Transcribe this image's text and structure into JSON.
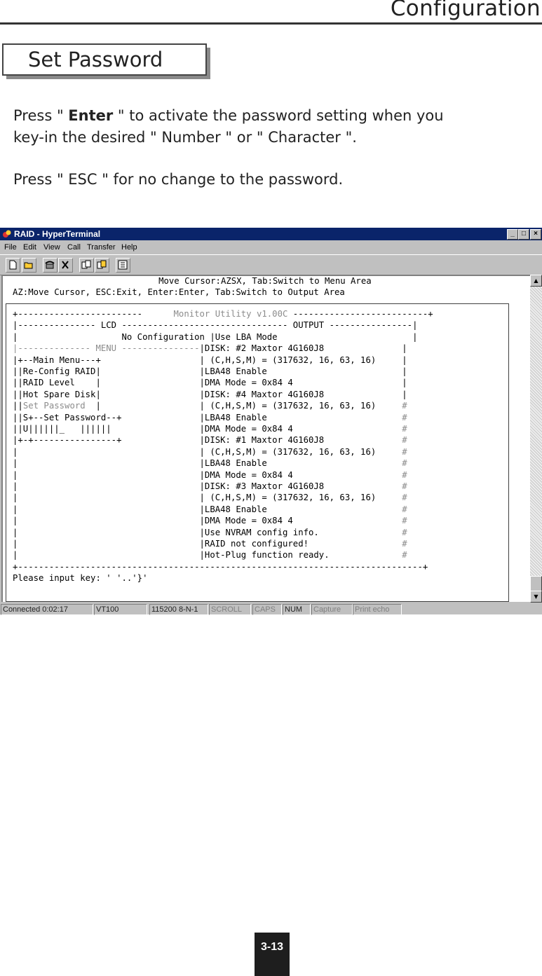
{
  "header": {
    "title": "Configuration"
  },
  "section": {
    "title": "Set Password"
  },
  "instructions": {
    "p1_prefix": "Press \" ",
    "p1_key": "Enter",
    "p1_suffix": " \" to activate the password setting when you",
    "p1_line2": "key-in  the desired \" Number \" or \" Character \".",
    "p2": "Press \" ESC \" for no change to the password."
  },
  "window": {
    "title": "RAID - HyperTerminal",
    "menu": [
      "File",
      "Edit",
      "View",
      "Call",
      "Transfer",
      "Help"
    ],
    "toolbar_icons": [
      "new-icon",
      "open-icon",
      "phone-icon",
      "disconnect-icon",
      "send-icon",
      "receive-icon",
      "properties-icon"
    ],
    "terminal": {
      "line1": "                              Move Cursor:AZSX, Tab:Switch to Menu Area",
      "line2": "AZ:Move Cursor, ESC:Exit, Enter:Enter, Tab:Switch to Output Area",
      "frame_top_left": "+------------------------",
      "frame_title": "      Monitor Utility v1.00C ",
      "frame_top_right": "--------------------------+",
      "lcd_header_a": "|--------------- LCD ",
      "lcd_header_b": "-------------------------------- OUTPUT ----------------|",
      "rows": [
        {
          "left": "|                    No Configuration ",
          "left_gray": "",
          "right": "|Use LBA Mode                          ",
          "end": "|"
        },
        {
          "left": "",
          "left_gray": "|-------------- MENU ---------------",
          "right": "|DISK: #2 Maxtor 4G160J8               ",
          "end": "|"
        },
        {
          "left": "|+--Main Menu---+                   ",
          "left_gray": "",
          "right": "| (C,H,S,M) = (317632, 16, 63, 16)     ",
          "end": "|"
        },
        {
          "left": "||Re-Config RAID|                   ",
          "left_gray": "",
          "right": "|LBA48 Enable                          ",
          "end": "|"
        },
        {
          "left": "||RAID Level    |                   ",
          "left_gray": "",
          "right": "|DMA Mode = 0x84 4                     ",
          "end": "|"
        },
        {
          "left": "||Hot Spare Disk|                   ",
          "left_gray": "",
          "right": "|DISK: #4 Maxtor 4G160J8               ",
          "end": "|"
        },
        {
          "left": "||",
          "left_gray": "Set Password  ",
          "left_tail": "|                   ",
          "right": "| (C,H,S,M) = (317632, 16, 63, 16)     ",
          "end": "#"
        },
        {
          "left": "||S+--Set Password--+               ",
          "left_gray": "",
          "right": "|LBA48 Enable                          ",
          "end": "#"
        },
        {
          "left": "||U||||||_   ||||||                 ",
          "left_gray": "",
          "right": "|DMA Mode = 0x84 4                     ",
          "end": "#"
        },
        {
          "left": "|+-+----------------+               ",
          "left_gray": "",
          "right": "|DISK: #1 Maxtor 4G160J8               ",
          "end": "#"
        },
        {
          "left": "|                                   ",
          "left_gray": "",
          "right": "| (C,H,S,M) = (317632, 16, 63, 16)     ",
          "end": "#"
        },
        {
          "left": "|                                   ",
          "left_gray": "",
          "right": "|LBA48 Enable                          ",
          "end": "#"
        },
        {
          "left": "|                                   ",
          "left_gray": "",
          "right": "|DMA Mode = 0x84 4                     ",
          "end": "#"
        },
        {
          "left": "|                                   ",
          "left_gray": "",
          "right": "|DISK: #3 Maxtor 4G160J8               ",
          "end": "#"
        },
        {
          "left": "|                                   ",
          "left_gray": "",
          "right": "| (C,H,S,M) = (317632, 16, 63, 16)     ",
          "end": "#"
        },
        {
          "left": "|                                   ",
          "left_gray": "",
          "right": "|LBA48 Enable                          ",
          "end": "#"
        },
        {
          "left": "|                                   ",
          "left_gray": "",
          "right": "|DMA Mode = 0x84 4                     ",
          "end": "#"
        },
        {
          "left": "|                                   ",
          "left_gray": "",
          "right": "|Use NVRAM config info.                ",
          "end": "#"
        },
        {
          "left": "|                                   ",
          "left_gray": "",
          "right": "|RAID not configured!                  ",
          "end": "#"
        },
        {
          "left": "|                                   ",
          "left_gray": "",
          "right": "|Hot-Plug function ready.              ",
          "end": "#"
        }
      ],
      "frame_bottom": "+------------------------------------------------------------------------------+",
      "prompt": "Please input key: ' '..'}'"
    },
    "status": {
      "connected": "Connected 0:02:17",
      "emulation": "VT100",
      "port": "115200 8-N-1",
      "scroll": "SCROLL",
      "caps": "CAPS",
      "num": "NUM",
      "capture": "Capture",
      "print_echo": "Print echo"
    }
  },
  "page_number": "3-13"
}
